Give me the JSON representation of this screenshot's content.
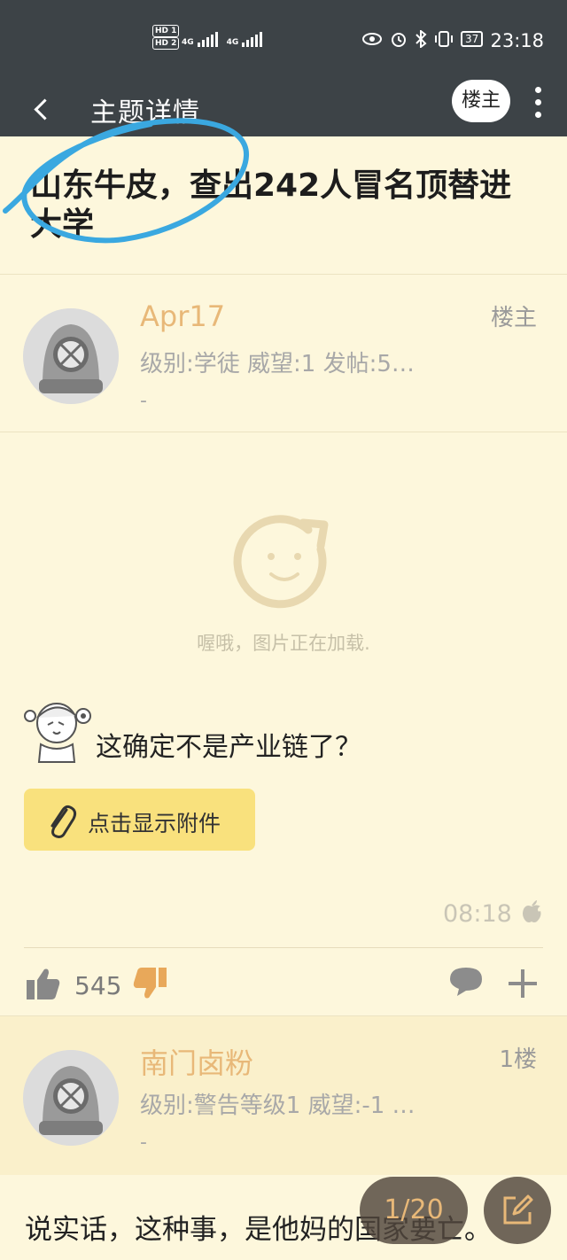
{
  "status_bar": {
    "network": [
      "HD 1",
      "HD 2"
    ],
    "signal_label_1": "4G",
    "signal_label_2": "4G",
    "battery": "37",
    "time": "23:18"
  },
  "header": {
    "title": "主题详情",
    "owner_button": "楼主"
  },
  "topic": {
    "title": "山东牛皮，查出242人冒名顶替进大学"
  },
  "posts": [
    {
      "username": "Apr17",
      "floor": "楼主",
      "meta": "级别:学徒   威望:1   发帖:5…",
      "dash": "-",
      "loading_text": "喔哦，图片正在加载.",
      "content": "这确定不是产业链了？",
      "attachment_label": "点击显示附件",
      "time": "08:18",
      "likes": "545"
    },
    {
      "username": "南门卤粉",
      "floor": "1楼",
      "meta": "级别:警告等级1   威望:-1   …",
      "dash": "-",
      "content": "说实话，这种事，是他妈的国家要亡。"
    }
  ],
  "pager": "1/20",
  "colors": {
    "background": "#fdf7dc",
    "bar": "#3d4347",
    "username": "#e8b878",
    "attachment_bg": "#f9e17d",
    "annotation": "#3aa8e0"
  }
}
